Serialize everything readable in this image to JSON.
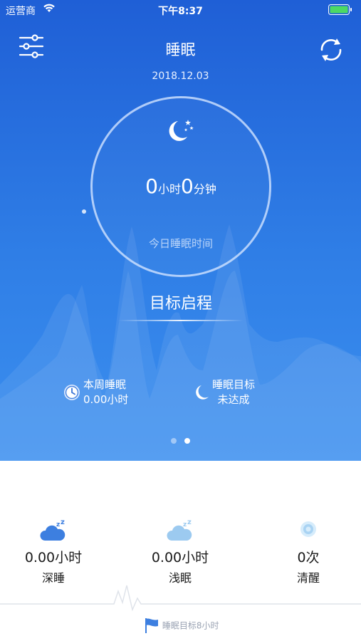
{
  "status_bar": {
    "carrier": "运营商",
    "time": "下午8:37"
  },
  "header": {
    "title": "睡眠",
    "date": "2018.12.03"
  },
  "ring": {
    "hours": "0",
    "hours_unit": "小时",
    "minutes": "0",
    "minutes_unit": "分钟",
    "caption": "今日睡眠时间"
  },
  "target_button": "目标启程",
  "stats": {
    "week": {
      "title": "本周睡眠",
      "value": "0.00小时"
    },
    "goal": {
      "title": "睡眠目标",
      "value": "未达成"
    }
  },
  "pager": {
    "count": 2,
    "active": 2
  },
  "metrics": [
    {
      "icon": "deep-sleep-cloud-icon",
      "value": "0.00小时",
      "label": "深睡"
    },
    {
      "icon": "light-sleep-cloud-icon",
      "value": "0.00小时",
      "label": "浅眠"
    },
    {
      "icon": "awake-circle-icon",
      "value": "0次",
      "label": "清醒"
    }
  ],
  "sleep_goal_label": "睡眠目标8小时",
  "colors": {
    "hero_top": "#1f5fd6",
    "hero_bottom": "#3b8fef",
    "accent": "#3d7fe0",
    "light_accent": "#9ccaf0"
  }
}
